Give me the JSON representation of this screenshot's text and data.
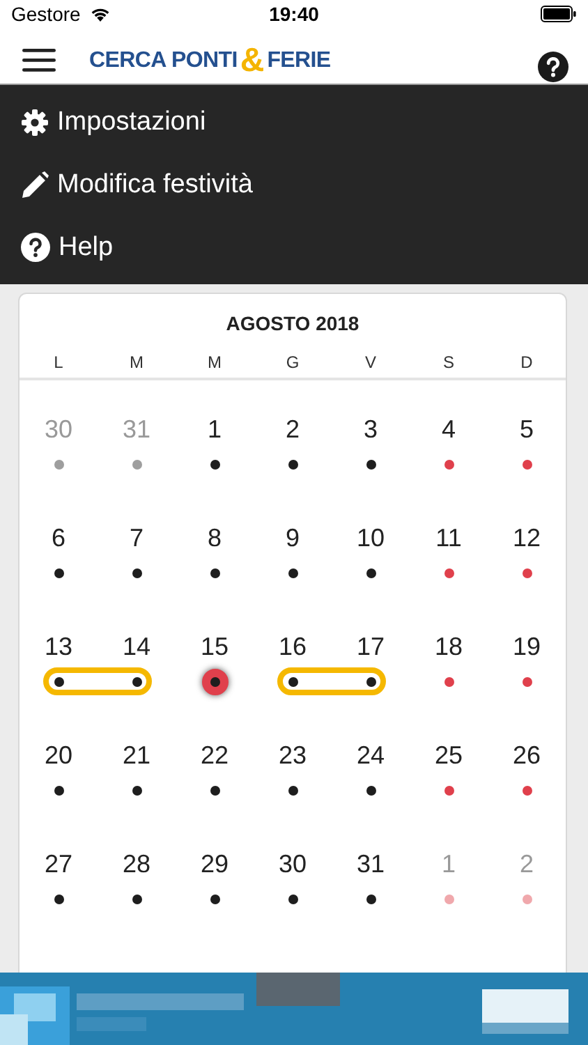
{
  "status_bar": {
    "carrier": "Gestore",
    "time": "19:40"
  },
  "nav": {
    "logo_left": "CERCA PONTI",
    "logo_mark": "&",
    "logo_right": "FERIE"
  },
  "menu": [
    {
      "kind": "settings",
      "label": "Impostazioni"
    },
    {
      "kind": "edit",
      "label": "Modifica festività"
    },
    {
      "kind": "help",
      "label": "Help"
    }
  ],
  "calendar": {
    "title": "AGOSTO 2018",
    "weekdays": [
      "L",
      "M",
      "M",
      "G",
      "V",
      "S",
      "D"
    ],
    "weeks": [
      [
        {
          "day": "30",
          "muted": true,
          "kind": "workday",
          "bridge": false
        },
        {
          "day": "31",
          "muted": true,
          "kind": "workday",
          "bridge": false
        },
        {
          "day": "1",
          "muted": false,
          "kind": "workday",
          "bridge": false
        },
        {
          "day": "2",
          "muted": false,
          "kind": "workday",
          "bridge": false
        },
        {
          "day": "3",
          "muted": false,
          "kind": "workday",
          "bridge": false
        },
        {
          "day": "4",
          "muted": false,
          "kind": "weekend",
          "bridge": false
        },
        {
          "day": "5",
          "muted": false,
          "kind": "weekend",
          "bridge": false
        }
      ],
      [
        {
          "day": "6",
          "muted": false,
          "kind": "workday",
          "bridge": false
        },
        {
          "day": "7",
          "muted": false,
          "kind": "workday",
          "bridge": false
        },
        {
          "day": "8",
          "muted": false,
          "kind": "workday",
          "bridge": false
        },
        {
          "day": "9",
          "muted": false,
          "kind": "workday",
          "bridge": false
        },
        {
          "day": "10",
          "muted": false,
          "kind": "workday",
          "bridge": false
        },
        {
          "day": "11",
          "muted": false,
          "kind": "weekend",
          "bridge": false
        },
        {
          "day": "12",
          "muted": false,
          "kind": "weekend",
          "bridge": false
        }
      ],
      [
        {
          "day": "13",
          "muted": false,
          "kind": "workday",
          "bridge": true
        },
        {
          "day": "14",
          "muted": false,
          "kind": "workday",
          "bridge": true
        },
        {
          "day": "15",
          "muted": false,
          "kind": "holiday",
          "bridge": false
        },
        {
          "day": "16",
          "muted": false,
          "kind": "workday",
          "bridge": true
        },
        {
          "day": "17",
          "muted": false,
          "kind": "workday",
          "bridge": true
        },
        {
          "day": "18",
          "muted": false,
          "kind": "weekend",
          "bridge": false
        },
        {
          "day": "19",
          "muted": false,
          "kind": "weekend",
          "bridge": false
        }
      ],
      [
        {
          "day": "20",
          "muted": false,
          "kind": "workday",
          "bridge": false
        },
        {
          "day": "21",
          "muted": false,
          "kind": "workday",
          "bridge": false
        },
        {
          "day": "22",
          "muted": false,
          "kind": "workday",
          "bridge": false
        },
        {
          "day": "23",
          "muted": false,
          "kind": "workday",
          "bridge": false
        },
        {
          "day": "24",
          "muted": false,
          "kind": "workday",
          "bridge": false
        },
        {
          "day": "25",
          "muted": false,
          "kind": "weekend",
          "bridge": false
        },
        {
          "day": "26",
          "muted": false,
          "kind": "weekend",
          "bridge": false
        }
      ],
      [
        {
          "day": "27",
          "muted": false,
          "kind": "workday",
          "bridge": false
        },
        {
          "day": "28",
          "muted": false,
          "kind": "workday",
          "bridge": false
        },
        {
          "day": "29",
          "muted": false,
          "kind": "workday",
          "bridge": false
        },
        {
          "day": "30",
          "muted": false,
          "kind": "workday",
          "bridge": false
        },
        {
          "day": "31",
          "muted": false,
          "kind": "workday",
          "bridge": false
        },
        {
          "day": "1",
          "muted": true,
          "kind": "weekend",
          "bridge": false
        },
        {
          "day": "2",
          "muted": true,
          "kind": "weekend",
          "bridge": false
        }
      ]
    ]
  }
}
